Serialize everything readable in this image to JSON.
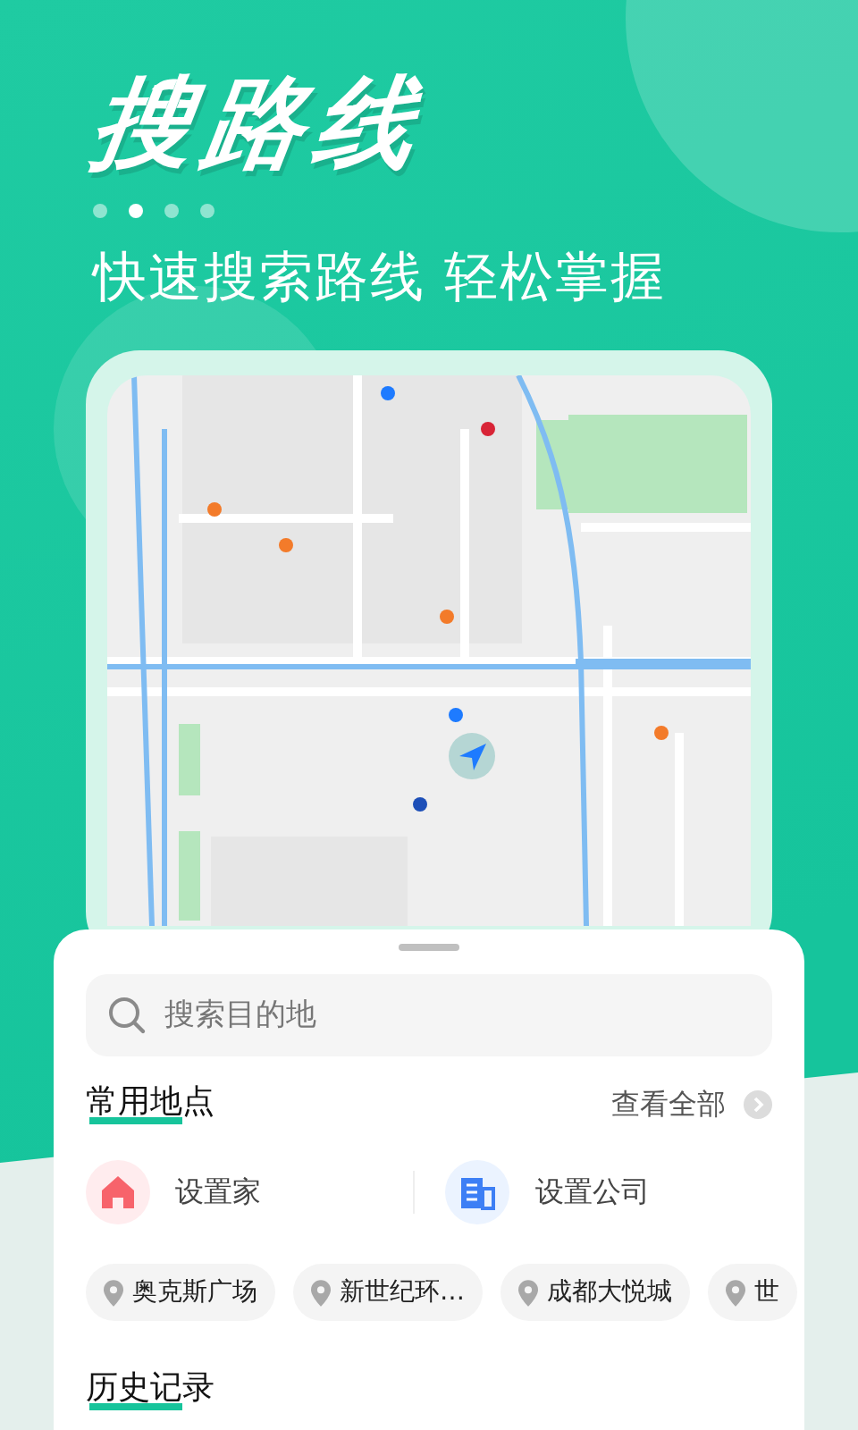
{
  "hero": {
    "title": "搜路线",
    "pager": [
      {
        "selected": false
      },
      {
        "selected": true
      },
      {
        "selected": false
      },
      {
        "selected": false
      }
    ],
    "subtitle": "快速搜索路线 轻松掌握"
  },
  "sheet": {
    "search": {
      "placeholder": "搜索目的地"
    },
    "common_places": {
      "heading": "常用地点",
      "view_all": "查看全部",
      "shortcuts": [
        {
          "kind": "home",
          "label": "设置家"
        },
        {
          "kind": "company",
          "label": "设置公司"
        }
      ],
      "chips": [
        "奥克斯广场",
        "新世纪环…",
        "成都大悦城",
        "世"
      ]
    },
    "history": {
      "heading": "历史记录"
    }
  }
}
